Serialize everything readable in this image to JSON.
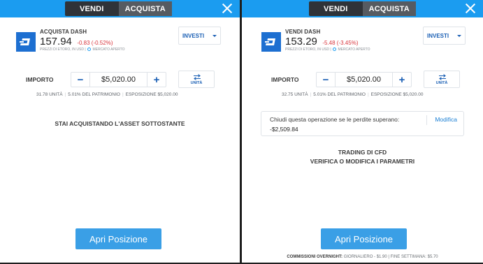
{
  "left": {
    "header": {
      "tab_sell": "VENDI",
      "tab_buy": "ACQUISTA",
      "active": "buy"
    },
    "asset": {
      "action": "ACQUISTA",
      "symbol": "DASH",
      "price": "157.94",
      "change": "-0.83 (-0.52%)",
      "price_note": "PREZZI DI ETORO, IN USD",
      "market_status": "MERCATO APERTO"
    },
    "invest_label": "INVESTI",
    "amount": {
      "label": "IMPORTO",
      "value": "$5,020.00",
      "minus": "−",
      "plus": "+",
      "units_label": "UNITÀ"
    },
    "stats": {
      "units": "31.78 UNITÀ",
      "equity": "5.01% DEL PATRIMONIO",
      "exposure": "ESPOSIZIONE $5,020.00"
    },
    "info_line1": "STAI ACQUISTANDO L'ASSET SOTTOSTANTE",
    "open_button": "Apri Posizione"
  },
  "right": {
    "header": {
      "tab_sell": "VENDI",
      "tab_buy": "ACQUISTA",
      "active": "buy"
    },
    "asset": {
      "action": "VENDI",
      "symbol": "DASH",
      "price": "153.29",
      "change": "-5.48 (-3.45%)",
      "price_note": "PREZZI DI ETORO, IN USD",
      "market_status": "MERCATO APERTO"
    },
    "invest_label": "INVESTI",
    "amount": {
      "label": "IMPORTO",
      "value": "$5,020.00",
      "minus": "−",
      "plus": "+",
      "units_label": "UNITÀ"
    },
    "stats": {
      "units": "32.75 UNITÀ",
      "equity": "5.01% DEL PATRIMONIO",
      "exposure": "ESPOSIZIONE $5,020.00"
    },
    "stop_loss": {
      "question": "Chiudi questa operazione se le perdite superano:",
      "value": "-$2,509.84",
      "edit": "Modifica"
    },
    "info_line1": "TRADING DI CFD",
    "info_line2": "VERIFICA O MODIFICA I PARAMETRI",
    "open_button": "Apri Posizione",
    "fees": {
      "label": "COMMISSIONI OVERNIGHT:",
      "daily": "GIORNALIERO - $1.90",
      "weekend": "FINE SETTIMANA: $5.70"
    }
  },
  "colors": {
    "header_blue": "#1b9cf0",
    "accent_blue": "#1a5fb4",
    "negative_red": "#d9363e",
    "button_blue": "#3a9fe6"
  }
}
